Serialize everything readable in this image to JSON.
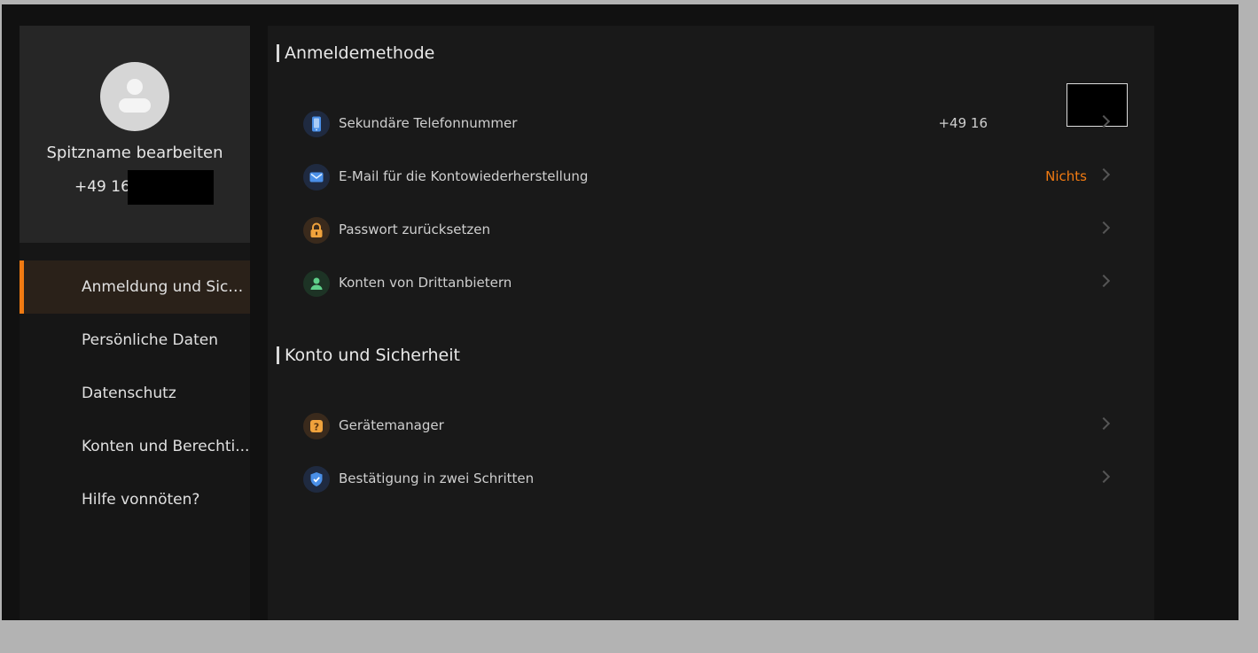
{
  "profile": {
    "nickname": "Spitzname bearbeiten",
    "phone": "+49 16"
  },
  "sidebar": {
    "items": [
      {
        "label": "Anmeldung und Sich..."
      },
      {
        "label": "Persönliche Daten"
      },
      {
        "label": "Datenschutz"
      },
      {
        "label": "Konten und Berechti..."
      },
      {
        "label": "Hilfe vonnöten?"
      }
    ]
  },
  "sections": [
    {
      "title": "Anmeldemethode",
      "rows": [
        {
          "label": "Sekundäre Telefonnummer",
          "value": "+49 16",
          "icon": "phone-icon"
        },
        {
          "label": "E-Mail für die Kontowiederherstellung",
          "value": "Nichts",
          "icon": "mail-icon"
        },
        {
          "label": "Passwort zurücksetzen",
          "value": "",
          "icon": "lock-icon"
        },
        {
          "label": "Konten von Drittanbietern",
          "value": "",
          "icon": "person-icon"
        }
      ]
    },
    {
      "title": "Konto und Sicherheit",
      "rows": [
        {
          "label": "Gerätemanager",
          "value": "",
          "icon": "device-help-icon"
        },
        {
          "label": "Bestätigung in zwei Schritten",
          "value": "",
          "icon": "shield-icon"
        }
      ]
    }
  ],
  "colors": {
    "accent": "#f07a12",
    "background": "#111111",
    "panel": "#191919"
  }
}
